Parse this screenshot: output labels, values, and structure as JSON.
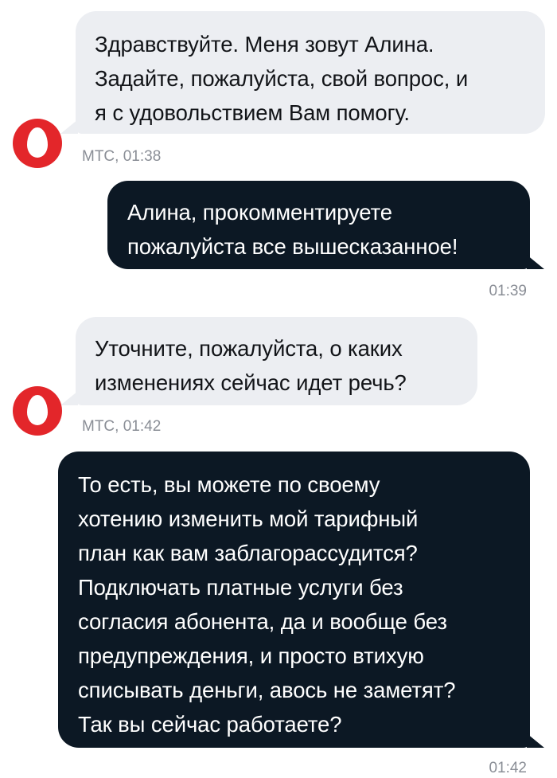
{
  "messages": [
    {
      "direction": "incoming",
      "text": "Здравствуйте. Меня зовут Алина.\nЗадайте, пожалуйста, свой вопрос, и\nя с удовольствием Вам помогу.",
      "meta": "МТС, 01:38"
    },
    {
      "direction": "outgoing",
      "text": "Алина, прокомментируете\nпожалуйста все вышесказанное!",
      "meta": "01:39"
    },
    {
      "direction": "incoming",
      "text": "Уточните, пожалуйста, о каких\nизменениях сейчас идет речь?",
      "meta": "МТС, 01:42"
    },
    {
      "direction": "outgoing",
      "text": "То есть, вы можете по своему\nхотению изменить мой тарифный\nплан как вам заблагорассудится?\nПодключать платные услуги без\nсогласия абонента, да и вообще без\nпредупреждения, и просто втихую\nсписывать деньги, авось не заметят?\nТак вы сейчас работаете?",
      "meta": "01:42"
    }
  ],
  "colors": {
    "incoming_bubble": "#eceef2",
    "outgoing_bubble": "#0c1824",
    "avatar_brand": "#e3262a",
    "meta_text": "#8a8e96"
  },
  "icons": {
    "operator_avatar": "mts-egg-logo-icon"
  }
}
